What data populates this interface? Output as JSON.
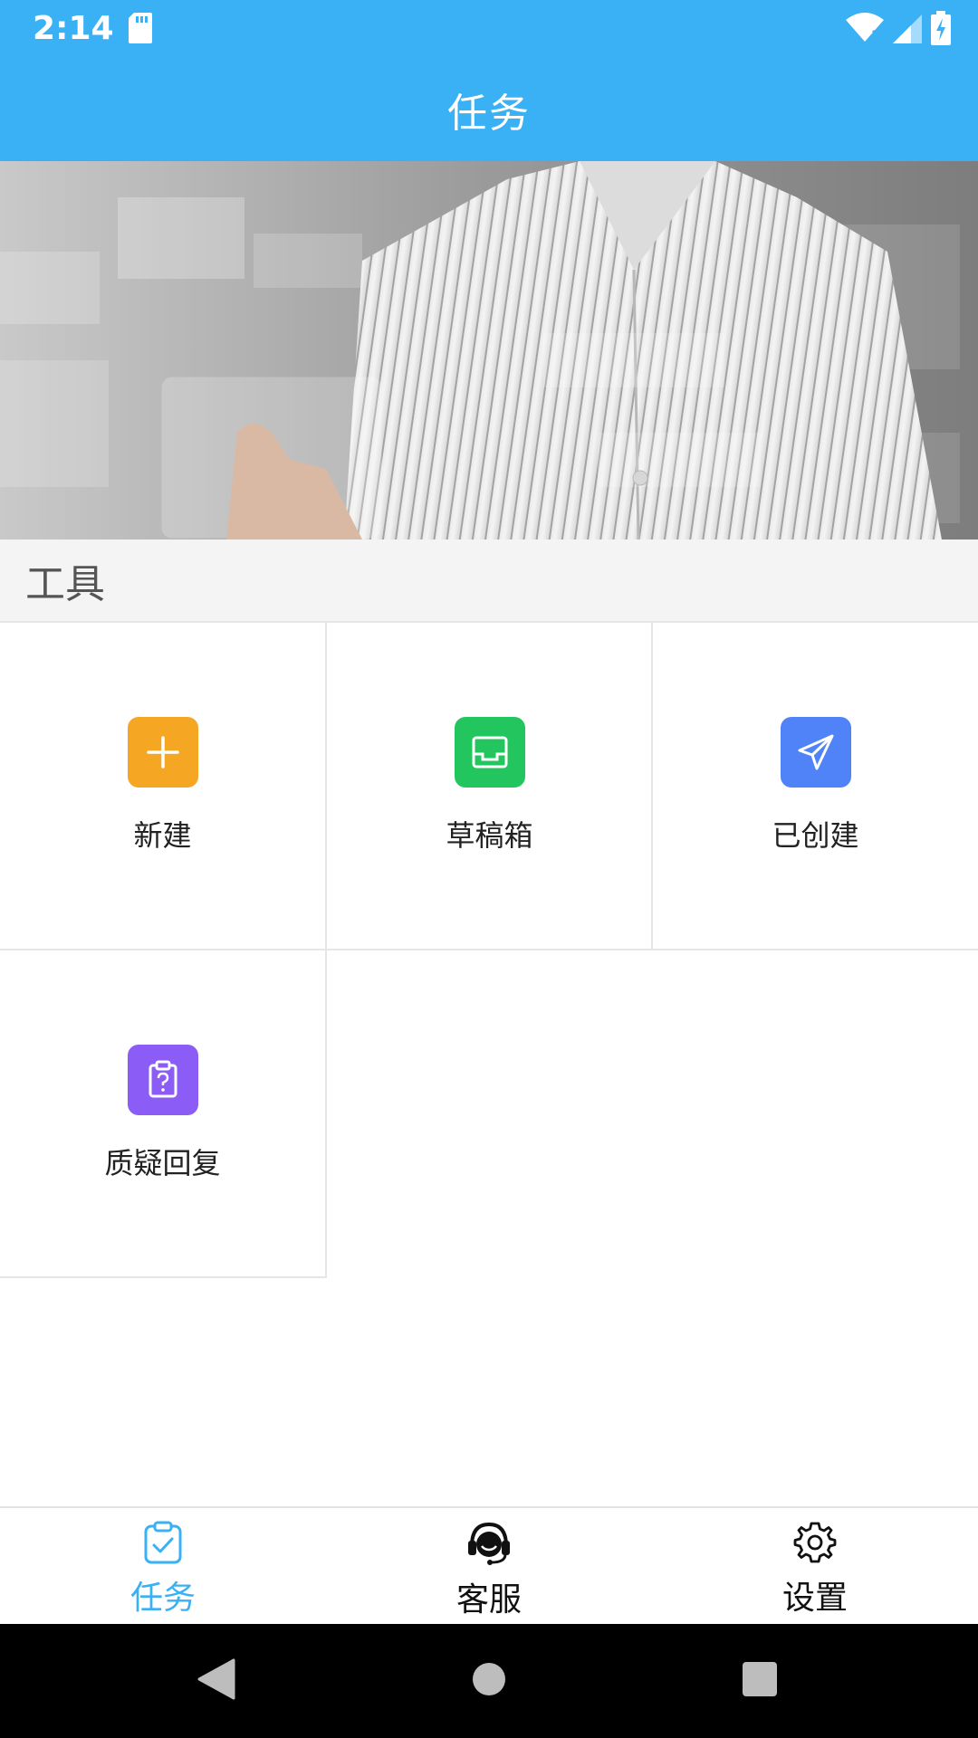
{
  "status_bar": {
    "time": "2:14"
  },
  "app_bar": {
    "title": "任务"
  },
  "section": {
    "title": "工具"
  },
  "tools": [
    {
      "label": "新建",
      "icon": "plus-icon",
      "color": "#f5a623"
    },
    {
      "label": "草稿箱",
      "icon": "inbox-icon",
      "color": "#22c55e"
    },
    {
      "label": "已创建",
      "icon": "paper-plane-icon",
      "color": "#4f83f7"
    },
    {
      "label": "质疑回复",
      "icon": "clipboard-question-icon",
      "color": "#8b5cf6"
    }
  ],
  "bottom_nav": [
    {
      "label": "任务",
      "icon": "clipboard-check-icon",
      "active": true
    },
    {
      "label": "客服",
      "icon": "headset-icon",
      "active": false
    },
    {
      "label": "设置",
      "icon": "gear-icon",
      "active": false
    }
  ],
  "colors": {
    "primary": "#3ab0f5",
    "active_nav": "#3ab0f5"
  }
}
